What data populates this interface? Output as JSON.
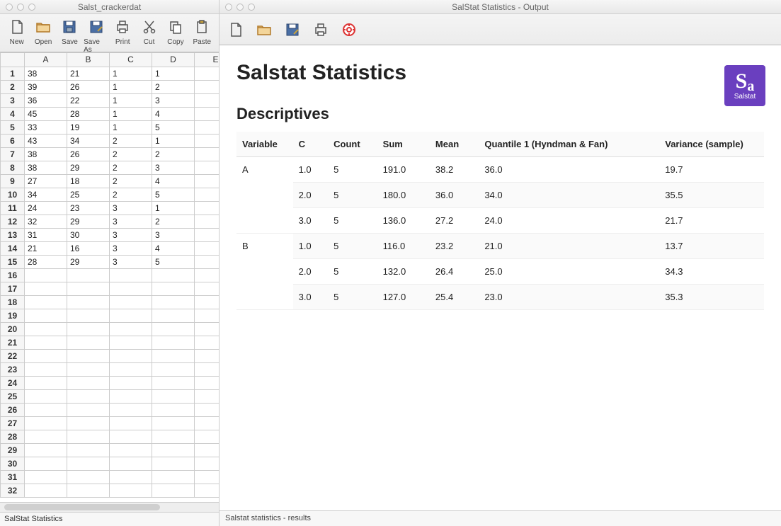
{
  "left_window": {
    "title": "Salst_crackerdat",
    "toolbar": [
      {
        "name": "new",
        "label": "New"
      },
      {
        "name": "open",
        "label": "Open"
      },
      {
        "name": "save",
        "label": "Save"
      },
      {
        "name": "saveas",
        "label": "Save As"
      },
      {
        "name": "print",
        "label": "Print"
      },
      {
        "name": "cut",
        "label": "Cut"
      },
      {
        "name": "copy",
        "label": "Copy"
      },
      {
        "name": "paste",
        "label": "Paste"
      }
    ],
    "columns": [
      "A",
      "B",
      "C",
      "D",
      "E"
    ],
    "row_count": 32,
    "data": [
      [
        "38",
        "21",
        "1",
        "1",
        ""
      ],
      [
        "39",
        "26",
        "1",
        "2",
        ""
      ],
      [
        "36",
        "22",
        "1",
        "3",
        ""
      ],
      [
        "45",
        "28",
        "1",
        "4",
        ""
      ],
      [
        "33",
        "19",
        "1",
        "5",
        ""
      ],
      [
        "43",
        "34",
        "2",
        "1",
        ""
      ],
      [
        "38",
        "26",
        "2",
        "2",
        ""
      ],
      [
        "38",
        "29",
        "2",
        "3",
        ""
      ],
      [
        "27",
        "18",
        "2",
        "4",
        ""
      ],
      [
        "34",
        "25",
        "2",
        "5",
        ""
      ],
      [
        "24",
        "23",
        "3",
        "1",
        ""
      ],
      [
        "32",
        "29",
        "3",
        "2",
        ""
      ],
      [
        "31",
        "30",
        "3",
        "3",
        ""
      ],
      [
        "21",
        "16",
        "3",
        "4",
        ""
      ],
      [
        "28",
        "29",
        "3",
        "5",
        ""
      ]
    ],
    "status": "SalStat Statistics"
  },
  "right_window": {
    "title": "SalStat Statistics - Output",
    "logo_text": "Salstat",
    "h1": "Salstat Statistics",
    "h2": "Descriptives",
    "desc_headers": [
      "Variable",
      "C",
      "Count",
      "Sum",
      "Mean",
      "Quantile 1 (Hyndman & Fan)",
      "Variance (sample)"
    ],
    "desc_rows": [
      {
        "var": "A",
        "c": "1.0",
        "count": "5",
        "sum": "191.0",
        "mean": "38.2",
        "q1": "36.0",
        "varsamp": "19.7"
      },
      {
        "var": "",
        "c": "2.0",
        "count": "5",
        "sum": "180.0",
        "mean": "36.0",
        "q1": "34.0",
        "varsamp": "35.5"
      },
      {
        "var": "",
        "c": "3.0",
        "count": "5",
        "sum": "136.0",
        "mean": "27.2",
        "q1": "24.0",
        "varsamp": "21.7"
      },
      {
        "var": "B",
        "c": "1.0",
        "count": "5",
        "sum": "116.0",
        "mean": "23.2",
        "q1": "21.0",
        "varsamp": "13.7"
      },
      {
        "var": "",
        "c": "2.0",
        "count": "5",
        "sum": "132.0",
        "mean": "26.4",
        "q1": "25.0",
        "varsamp": "34.3"
      },
      {
        "var": "",
        "c": "3.0",
        "count": "5",
        "sum": "127.0",
        "mean": "25.4",
        "q1": "23.0",
        "varsamp": "35.3"
      }
    ],
    "status": "Salstat statistics - results"
  }
}
